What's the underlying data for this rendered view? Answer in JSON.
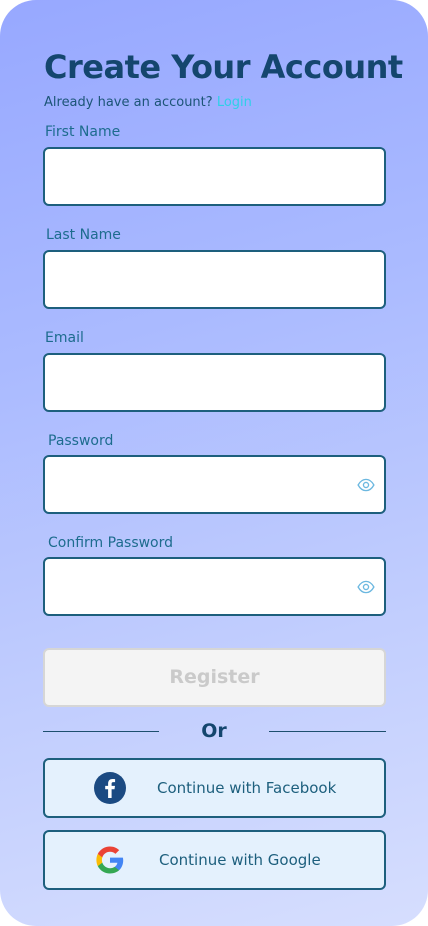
{
  "header": {
    "title": "Create Your Account",
    "signin_prompt": "Already have an account?",
    "signin_link": "Login"
  },
  "form": {
    "first_name": {
      "label": "First Name",
      "value": ""
    },
    "last_name": {
      "label": "Last Name",
      "value": ""
    },
    "email": {
      "label": "Email",
      "value": ""
    },
    "password": {
      "label": "Password",
      "value": "",
      "visibility_icon": "eye-icon"
    },
    "confirm_password": {
      "label": "Confirm Password",
      "value": "",
      "visibility_icon": "eye-icon"
    },
    "register_label": "Register",
    "register_enabled": false
  },
  "divider": {
    "label": "Or"
  },
  "social": {
    "facebook": {
      "label": "Continue with Facebook",
      "icon": "facebook-icon"
    },
    "google": {
      "label": "Continue with Google",
      "icon": "google-icon"
    }
  },
  "colors": {
    "title": "#14466e",
    "link": "#2ed0e8",
    "field_border": "#1d5f7d",
    "social_bg": "#e4f1fd",
    "facebook_brand": "#1b4a82",
    "gradient_top": "#97a8ff",
    "gradient_bottom": "#d6defe"
  }
}
